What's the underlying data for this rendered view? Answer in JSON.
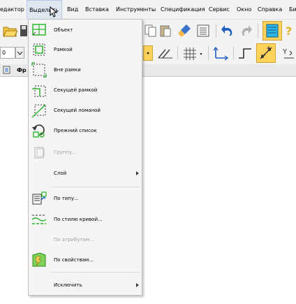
{
  "menubar": {
    "items": [
      "едактор",
      "Выделить",
      "Вид",
      "Вставка",
      "Инструменты",
      "Спецификация",
      "Сервис",
      "Окно",
      "Справка",
      "Би"
    ]
  },
  "toolbar": {
    "scale_value": "0",
    "doc_tab_label": "Фр"
  },
  "select_menu": {
    "items": [
      {
        "label": "Объект",
        "icon": "object-select-icon",
        "enabled": true
      },
      {
        "label": "Рамкой",
        "icon": "frame-select-icon",
        "enabled": true
      },
      {
        "label": "Вне рамки",
        "icon": "outside-frame-icon",
        "enabled": true
      },
      {
        "label": "Секущей рамкой",
        "icon": "crossing-frame-icon",
        "enabled": true
      },
      {
        "label": "Секущей ломаной",
        "icon": "crossing-polyline-icon",
        "enabled": true
      },
      {
        "label": "Прежний список",
        "icon": "previous-list-icon",
        "enabled": true
      },
      {
        "label": "Группу...",
        "icon": "group-icon",
        "enabled": false
      },
      {
        "label": "Слой",
        "icon": "",
        "enabled": true,
        "submenu": true
      },
      {
        "label": "По типу...",
        "icon": "by-type-icon",
        "enabled": true
      },
      {
        "label": "По стилю кривой...",
        "icon": "by-curve-style-icon",
        "enabled": true
      },
      {
        "label": "По атрибутам...",
        "icon": "",
        "enabled": false
      },
      {
        "label": "По свойствам...",
        "icon": "by-properties-icon",
        "enabled": true
      },
      {
        "label": "Исключить",
        "icon": "",
        "enabled": true,
        "submenu": true
      }
    ]
  },
  "colors": {
    "accent_green": "#2db52d",
    "toolbar_bg": "#f3f3f3",
    "highlight_yellow": "#ffd35a",
    "nav_blue": "#1f5fbf",
    "cyan_button": "#2fb6e6"
  }
}
